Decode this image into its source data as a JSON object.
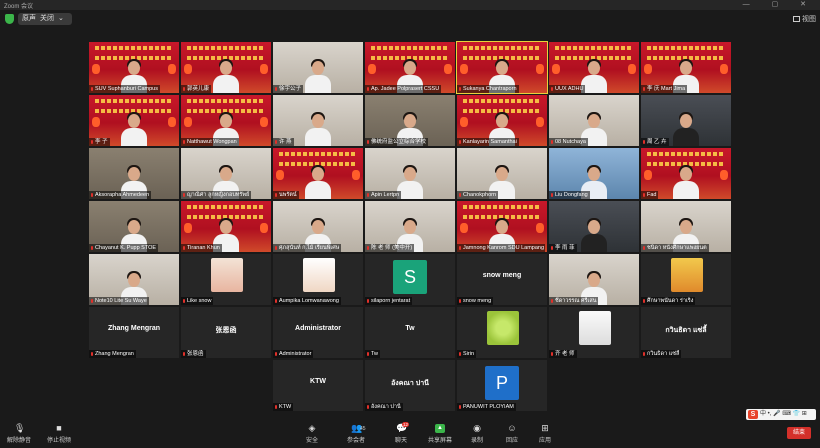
{
  "window": {
    "title": "Zoom 会议",
    "controls": "— ▢ ✕"
  },
  "topbar": {
    "view_label": "原声",
    "close_label": "关闭",
    "gallery_button": "视图"
  },
  "participants": [
    {
      "name": "SUV Suphanburi Campus",
      "kind": "banner"
    },
    {
      "name": "郭英儿康",
      "kind": "banner"
    },
    {
      "name": "徐宇公子",
      "kind": "wall"
    },
    {
      "name": "Ap. Jadee Polprasert CSSU",
      "kind": "banner"
    },
    {
      "name": "Sukanya Chantraporn",
      "kind": "banner",
      "active": true
    },
    {
      "name": "UUX ADHU",
      "kind": "banner"
    },
    {
      "name": "李 庆 Mart Jima",
      "kind": "banner"
    },
    {
      "name": "李 子",
      "kind": "banner"
    },
    {
      "name": "Natthawut Wongpan",
      "kind": "banner"
    },
    {
      "name": "许 燕",
      "kind": "wall"
    },
    {
      "name": "佛统府监公立综合学校",
      "kind": "room"
    },
    {
      "name": "Kanlayarin Samanthai",
      "kind": "banner"
    },
    {
      "name": "08 Nutchaya",
      "kind": "wall"
    },
    {
      "name": "周 乙 卉",
      "kind": "dark"
    },
    {
      "name": "Aksorapha Ahmedeen",
      "kind": "room"
    },
    {
      "name": "ญาณิศา ลูกหญิงกอบทรัพย์",
      "kind": "wall"
    },
    {
      "name": "นพรัตน์",
      "kind": "banner"
    },
    {
      "name": "Apin Lertpn",
      "kind": "wall"
    },
    {
      "name": "Chanokphorn",
      "kind": "wall"
    },
    {
      "name": "Liu Dongfang",
      "kind": "blue"
    },
    {
      "name": "Fad",
      "kind": "banner"
    },
    {
      "name": "Chayanut K. Pupp STOE",
      "kind": "room"
    },
    {
      "name": "Tiranan Khun",
      "kind": "banner"
    },
    {
      "name": "ศุภสุนันท์ ก.ไม้ เรียนพิเศษ",
      "kind": "wall"
    },
    {
      "name": "陈 老 师 (美中开)",
      "kind": "wall"
    },
    {
      "name": "Jamnong Kanrom SDU Lampang",
      "kind": "banner"
    },
    {
      "name": "李 雨 菲",
      "kind": "dark"
    },
    {
      "name": "ชนิดา หนังศึกษาแพงยนต",
      "kind": "wall"
    },
    {
      "name": "Note10 Lite Su Waye",
      "kind": "wall"
    },
    {
      "name": "Like snow",
      "kind": "avatar-anime"
    },
    {
      "name": "Aumpika Lomwanawong",
      "kind": "avatar-cartoon"
    },
    {
      "name": "silaporn jentarat",
      "kind": "letter",
      "letter": "S",
      "letter_color": "#1aa37a"
    },
    {
      "name": "snow meng",
      "kind": "text",
      "display": "snow meng"
    },
    {
      "name": "ชีดาวรรณ ศรีเสน",
      "kind": "wall"
    },
    {
      "name": "ศึกษาพนันดา ร่าเริง",
      "kind": "avatar-flower"
    },
    {
      "name": "Zhang Mengran",
      "kind": "text",
      "display": "Zhang Mengran"
    },
    {
      "name": "张恩函",
      "kind": "text",
      "display": "张恩函"
    },
    {
      "name": "Administrator",
      "kind": "text",
      "display": "Administrator"
    },
    {
      "name": "Tw",
      "kind": "text",
      "display": "Tw"
    },
    {
      "name": "Sirin",
      "kind": "avatar-green"
    },
    {
      "name": "齐 老 师",
      "kind": "avatar-meme"
    },
    {
      "name": "กวินธิดา แซ่ลี้",
      "kind": "text",
      "display": "กวินธิดา แซ่ลี้"
    },
    {
      "name": "KTW",
      "kind": "text",
      "display": "KTW"
    },
    {
      "name": "อังคณา ปานี",
      "kind": "text",
      "display": "อังคณา ปานี"
    },
    {
      "name": "PANUWIT PLOYIAM",
      "kind": "letter",
      "letter": "P",
      "letter_color": "#1f6fc9"
    }
  ],
  "toolbar": {
    "mute": "解除静音",
    "video": "停止视频",
    "security": "安全",
    "participants": "参会者",
    "participants_count": "45",
    "chat": "聊天",
    "chat_badge": "12",
    "share": "共享屏幕",
    "record": "录制",
    "reactions": "回应",
    "apps": "应用",
    "end": "结束"
  },
  "ime": {
    "text": "中 •, 🎤 ⌨ 👕 ⊞"
  },
  "colors": {
    "end": "#d4302a",
    "active_border": "#e8d23b",
    "share_green": "#3bb54a"
  }
}
